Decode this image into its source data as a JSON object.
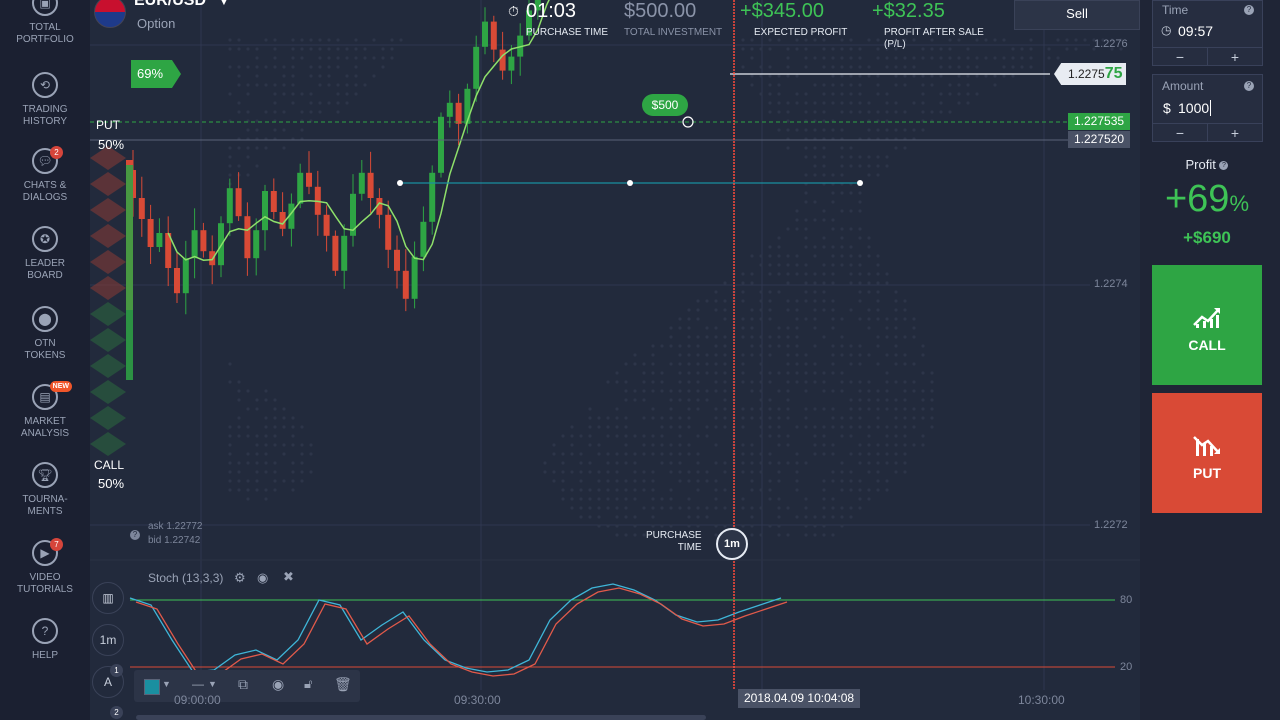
{
  "sidebar": {
    "items": [
      {
        "label": "TOTAL\nPORTFOLIO",
        "icon": "briefcase-icon",
        "badge": ""
      },
      {
        "label": "TRADING\nHISTORY",
        "icon": "history-icon",
        "badge": ""
      },
      {
        "label": "CHATS &\nDIALOGS",
        "icon": "chat-icon",
        "badge": "2"
      },
      {
        "label": "LEADER\nBOARD",
        "icon": "leader-icon",
        "badge": ""
      },
      {
        "label": "OTN\nTOKENS",
        "icon": "token-icon",
        "badge": ""
      },
      {
        "label": "MARKET\nANALYSIS",
        "icon": "news-icon",
        "badge": "NEW"
      },
      {
        "label": "TOURNA-\nMENTS",
        "icon": "trophy-icon",
        "badge": ""
      },
      {
        "label": "VIDEO\nTUTORIALS",
        "icon": "play-icon",
        "badge": "7"
      },
      {
        "label": "HELP",
        "icon": "help-icon",
        "badge": ""
      }
    ]
  },
  "asset": {
    "name": "EUR/USD",
    "type": "Option"
  },
  "header": {
    "purchase_time": {
      "value": "01:03",
      "label": "PURCHASE TIME"
    },
    "total_investment": {
      "value": "$500.00",
      "label": "TOTAL INVESTMENT"
    },
    "expected_profit": {
      "value": "+$345.00",
      "label": "EXPECTED PROFIT"
    },
    "profit_after_sale": {
      "value": "+$32.35",
      "label": "PROFIT AFTER SALE\n(P/L)"
    },
    "sell_label": "Sell"
  },
  "chart": {
    "payout_badge": "69%",
    "put_label": "PUT",
    "put_pct": "50%",
    "call_label": "CALL",
    "call_pct": "50%",
    "bet_badge": "$500",
    "current_price_prefix": "1.2275",
    "current_price_suffix": "75",
    "bet_price": "1.227535",
    "strike_price": "1.227520",
    "y_ticks": [
      "1.2276",
      "1.2274",
      "1.2272"
    ],
    "ask": "ask 1.22772",
    "bid": "bid 1.22742",
    "purchase_time_label": "PURCHASE\nTIME",
    "purchase_timer": "1m",
    "x_ticks": [
      "09:00:00",
      "09:30:00",
      "10:30:00"
    ],
    "cursor_time": "2018.04.09 10:04:08",
    "indicator": "Stoch (13,3,3)",
    "stoch_levels": [
      "80",
      "20"
    ],
    "timeframe": "1m",
    "tool_counts": [
      "1",
      "2"
    ]
  },
  "right_panel": {
    "time_label": "Time",
    "time_value": "09:57",
    "amount_label": "Amount",
    "amount_currency": "$",
    "amount_value": "1000",
    "profit_label": "Profit",
    "profit_pct": "+69",
    "profit_pct_sign": "%",
    "profit_amount": "+$690",
    "call_label": "CALL",
    "put_label": "PUT",
    "minus": "−",
    "plus": "+"
  },
  "colors": {
    "up": "#2ea544",
    "down": "#d94a36",
    "ma": "#8ee06a",
    "bg": "#222a3c",
    "accent": "#3ec356"
  }
}
